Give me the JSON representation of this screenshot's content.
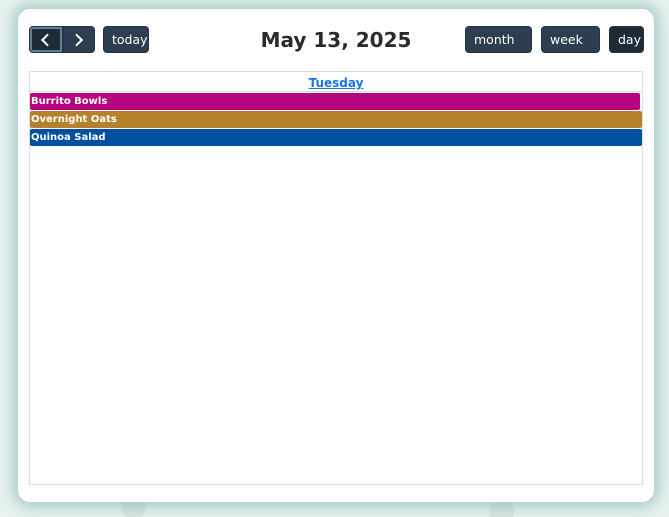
{
  "toolbar": {
    "prev_icon": "chevron-left-icon",
    "next_icon": "chevron-right-icon",
    "today_label": "today",
    "title": "May 13, 2025",
    "views": {
      "month": "month",
      "week": "week",
      "day": "day"
    },
    "active_view": "day"
  },
  "day_view": {
    "day_name": "Tuesday",
    "events": [
      {
        "title": "Burrito Bowls",
        "color": "#b5067f"
      },
      {
        "title": "Overnight Oats",
        "color": "#b5812a"
      },
      {
        "title": "Quinoa Salad",
        "color": "#0150a2"
      }
    ]
  }
}
